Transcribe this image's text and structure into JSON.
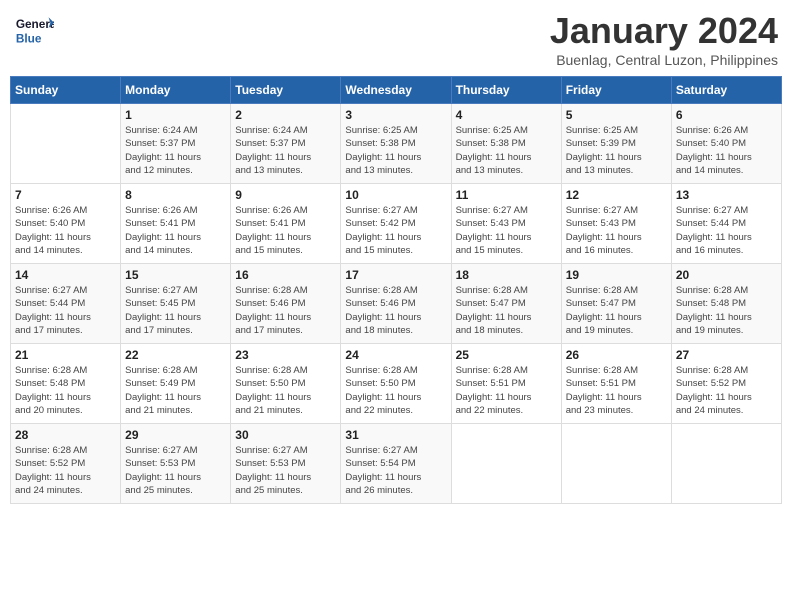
{
  "header": {
    "logo_line1": "General",
    "logo_line2": "Blue",
    "month_title": "January 2024",
    "subtitle": "Buenlag, Central Luzon, Philippines"
  },
  "weekdays": [
    "Sunday",
    "Monday",
    "Tuesday",
    "Wednesday",
    "Thursday",
    "Friday",
    "Saturday"
  ],
  "weeks": [
    [
      {
        "day": "",
        "info": ""
      },
      {
        "day": "1",
        "info": "Sunrise: 6:24 AM\nSunset: 5:37 PM\nDaylight: 11 hours\nand 12 minutes."
      },
      {
        "day": "2",
        "info": "Sunrise: 6:24 AM\nSunset: 5:37 PM\nDaylight: 11 hours\nand 13 minutes."
      },
      {
        "day": "3",
        "info": "Sunrise: 6:25 AM\nSunset: 5:38 PM\nDaylight: 11 hours\nand 13 minutes."
      },
      {
        "day": "4",
        "info": "Sunrise: 6:25 AM\nSunset: 5:38 PM\nDaylight: 11 hours\nand 13 minutes."
      },
      {
        "day": "5",
        "info": "Sunrise: 6:25 AM\nSunset: 5:39 PM\nDaylight: 11 hours\nand 13 minutes."
      },
      {
        "day": "6",
        "info": "Sunrise: 6:26 AM\nSunset: 5:40 PM\nDaylight: 11 hours\nand 14 minutes."
      }
    ],
    [
      {
        "day": "7",
        "info": "Sunrise: 6:26 AM\nSunset: 5:40 PM\nDaylight: 11 hours\nand 14 minutes."
      },
      {
        "day": "8",
        "info": "Sunrise: 6:26 AM\nSunset: 5:41 PM\nDaylight: 11 hours\nand 14 minutes."
      },
      {
        "day": "9",
        "info": "Sunrise: 6:26 AM\nSunset: 5:41 PM\nDaylight: 11 hours\nand 15 minutes."
      },
      {
        "day": "10",
        "info": "Sunrise: 6:27 AM\nSunset: 5:42 PM\nDaylight: 11 hours\nand 15 minutes."
      },
      {
        "day": "11",
        "info": "Sunrise: 6:27 AM\nSunset: 5:43 PM\nDaylight: 11 hours\nand 15 minutes."
      },
      {
        "day": "12",
        "info": "Sunrise: 6:27 AM\nSunset: 5:43 PM\nDaylight: 11 hours\nand 16 minutes."
      },
      {
        "day": "13",
        "info": "Sunrise: 6:27 AM\nSunset: 5:44 PM\nDaylight: 11 hours\nand 16 minutes."
      }
    ],
    [
      {
        "day": "14",
        "info": "Sunrise: 6:27 AM\nSunset: 5:44 PM\nDaylight: 11 hours\nand 17 minutes."
      },
      {
        "day": "15",
        "info": "Sunrise: 6:27 AM\nSunset: 5:45 PM\nDaylight: 11 hours\nand 17 minutes."
      },
      {
        "day": "16",
        "info": "Sunrise: 6:28 AM\nSunset: 5:46 PM\nDaylight: 11 hours\nand 17 minutes."
      },
      {
        "day": "17",
        "info": "Sunrise: 6:28 AM\nSunset: 5:46 PM\nDaylight: 11 hours\nand 18 minutes."
      },
      {
        "day": "18",
        "info": "Sunrise: 6:28 AM\nSunset: 5:47 PM\nDaylight: 11 hours\nand 18 minutes."
      },
      {
        "day": "19",
        "info": "Sunrise: 6:28 AM\nSunset: 5:47 PM\nDaylight: 11 hours\nand 19 minutes."
      },
      {
        "day": "20",
        "info": "Sunrise: 6:28 AM\nSunset: 5:48 PM\nDaylight: 11 hours\nand 19 minutes."
      }
    ],
    [
      {
        "day": "21",
        "info": "Sunrise: 6:28 AM\nSunset: 5:48 PM\nDaylight: 11 hours\nand 20 minutes."
      },
      {
        "day": "22",
        "info": "Sunrise: 6:28 AM\nSunset: 5:49 PM\nDaylight: 11 hours\nand 21 minutes."
      },
      {
        "day": "23",
        "info": "Sunrise: 6:28 AM\nSunset: 5:50 PM\nDaylight: 11 hours\nand 21 minutes."
      },
      {
        "day": "24",
        "info": "Sunrise: 6:28 AM\nSunset: 5:50 PM\nDaylight: 11 hours\nand 22 minutes."
      },
      {
        "day": "25",
        "info": "Sunrise: 6:28 AM\nSunset: 5:51 PM\nDaylight: 11 hours\nand 22 minutes."
      },
      {
        "day": "26",
        "info": "Sunrise: 6:28 AM\nSunset: 5:51 PM\nDaylight: 11 hours\nand 23 minutes."
      },
      {
        "day": "27",
        "info": "Sunrise: 6:28 AM\nSunset: 5:52 PM\nDaylight: 11 hours\nand 24 minutes."
      }
    ],
    [
      {
        "day": "28",
        "info": "Sunrise: 6:28 AM\nSunset: 5:52 PM\nDaylight: 11 hours\nand 24 minutes."
      },
      {
        "day": "29",
        "info": "Sunrise: 6:27 AM\nSunset: 5:53 PM\nDaylight: 11 hours\nand 25 minutes."
      },
      {
        "day": "30",
        "info": "Sunrise: 6:27 AM\nSunset: 5:53 PM\nDaylight: 11 hours\nand 25 minutes."
      },
      {
        "day": "31",
        "info": "Sunrise: 6:27 AM\nSunset: 5:54 PM\nDaylight: 11 hours\nand 26 minutes."
      },
      {
        "day": "",
        "info": ""
      },
      {
        "day": "",
        "info": ""
      },
      {
        "day": "",
        "info": ""
      }
    ]
  ]
}
